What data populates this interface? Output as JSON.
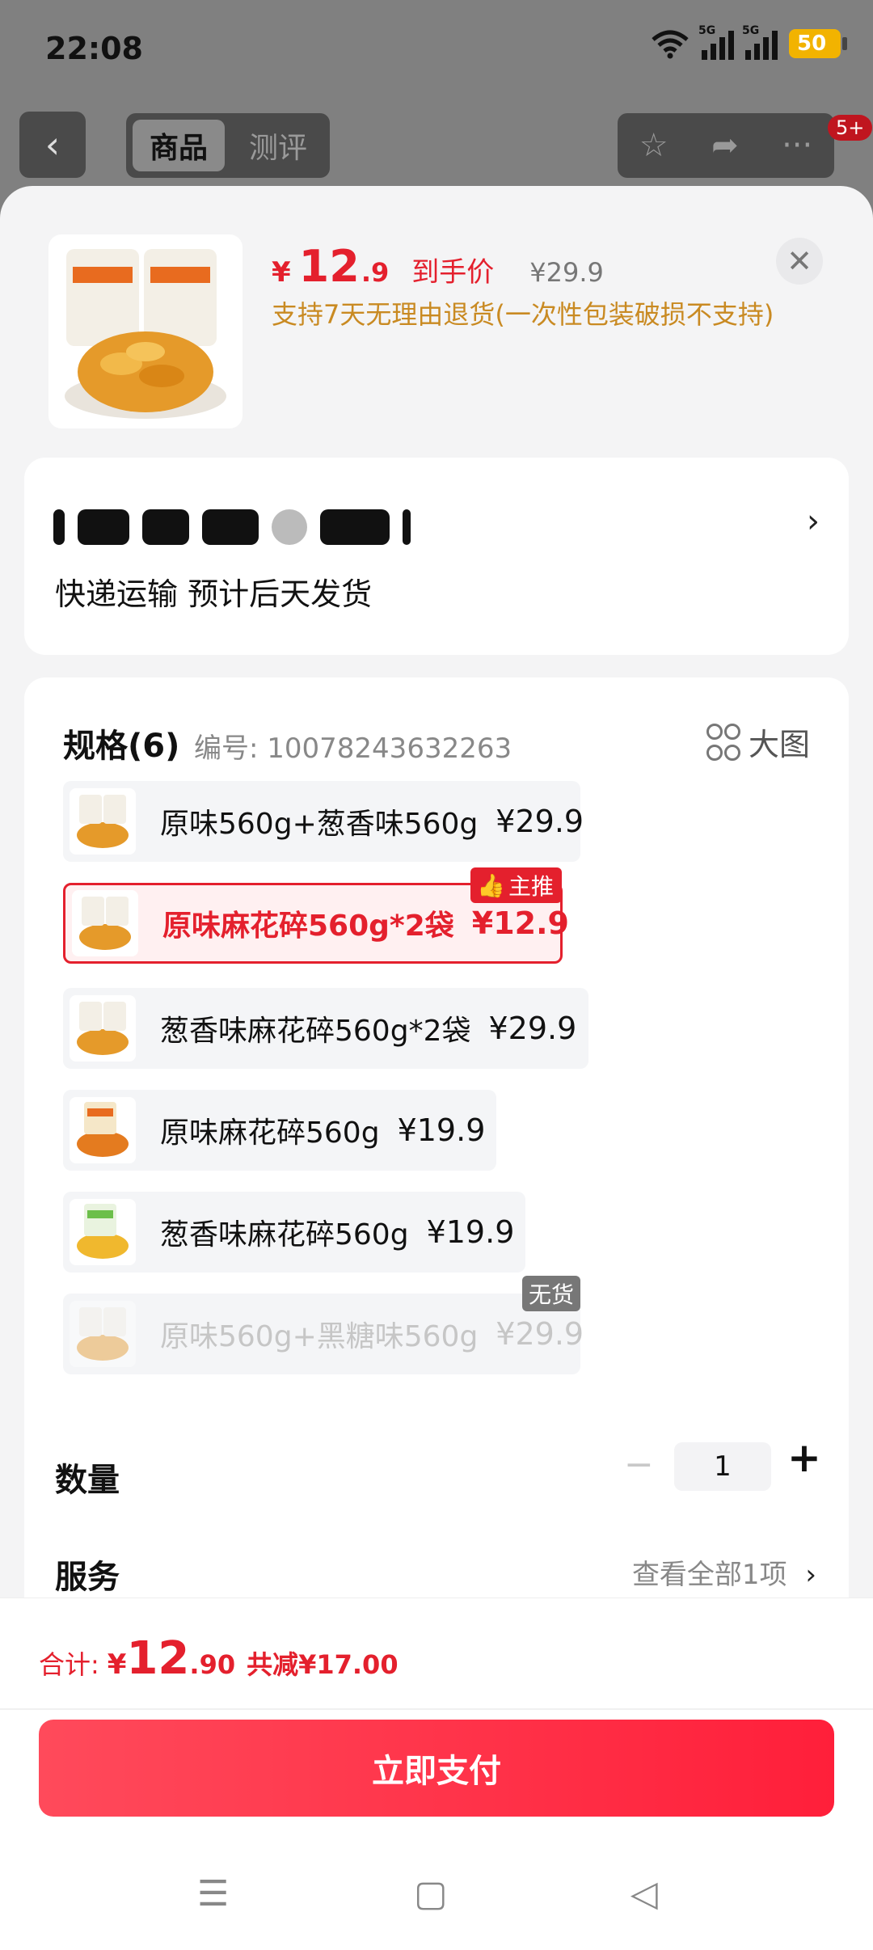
{
  "status_bar": {
    "time": "22:08",
    "net1": "5G",
    "net2": "5G",
    "battery": "50"
  },
  "top_nav": {
    "back": "‹",
    "tabs": [
      {
        "label": "商品"
      },
      {
        "label": "测评"
      }
    ],
    "badge": "5+"
  },
  "product": {
    "currency": "¥",
    "price_int": "12",
    "price_dec": ".9",
    "price_note": "到手价",
    "original_price": "¥29.9",
    "return_policy": "支持7天无理由退货(一次性包装破损不支持)"
  },
  "shipping": {
    "text": "快递运输 预计后天发货"
  },
  "spec": {
    "title": "规格(6)",
    "code": "编号: 10078243632263",
    "big_view": "大图",
    "options": [
      {
        "label": "原味560g+葱香味560g",
        "price": "¥29.9",
        "state": "normal"
      },
      {
        "label": "原味麻花碎560g*2袋",
        "price": "¥12.9",
        "state": "selected",
        "tag": "主推"
      },
      {
        "label": "葱香味麻花碎560g*2袋",
        "price": "¥29.9",
        "state": "normal"
      },
      {
        "label": "原味麻花碎560g",
        "price": "¥19.9",
        "state": "normal"
      },
      {
        "label": "葱香味麻花碎560g",
        "price": "¥19.9",
        "state": "normal"
      },
      {
        "label": "原味560g+黑糖味560g",
        "price": "¥29.9",
        "state": "disabled",
        "tag": "无货"
      }
    ]
  },
  "quantity": {
    "label": "数量",
    "value": "1"
  },
  "service": {
    "label": "服务",
    "link": "查看全部1项"
  },
  "footer": {
    "total_label": "合计:",
    "total_currency": "¥",
    "total_int": "12",
    "total_dec": ".90",
    "discount": "共减¥17.00",
    "pay_button": "立即支付"
  },
  "colors": {
    "accent": "#e4202d",
    "policy": "#c98a22",
    "pay_start": "#ff4a5b",
    "pay_end": "#ff1f3a"
  }
}
